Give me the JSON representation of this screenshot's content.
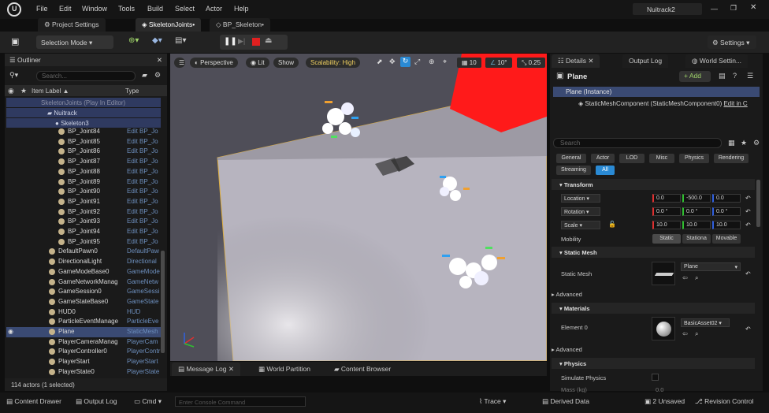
{
  "menubar": {
    "items": [
      "File",
      "Edit",
      "Window",
      "Tools",
      "Build",
      "Select",
      "Actor",
      "Help"
    ],
    "project": "Nuitrack2"
  },
  "tabs": [
    {
      "label": "Project Settings"
    },
    {
      "label": "SkeletonJoints•"
    },
    {
      "label": "BP_Skeleton•"
    }
  ],
  "toolbar": {
    "mode_label": "Selection Mode",
    "settings_label": "Settings"
  },
  "outliner": {
    "title": "Outliner",
    "search_placeholder": "Search...",
    "col_label": "Item Label ▲",
    "col_type": "Type",
    "root": "SkeletonJoints (Play In Editor)",
    "folder": "Nuitrack",
    "skeleton": "Skeleton3",
    "rows": [
      {
        "label": "BP_Joint84",
        "type": "Edit BP_Jo"
      },
      {
        "label": "BP_Joint85",
        "type": "Edit BP_Jo"
      },
      {
        "label": "BP_Joint86",
        "type": "Edit BP_Jo"
      },
      {
        "label": "BP_Joint87",
        "type": "Edit BP_Jo"
      },
      {
        "label": "BP_Joint88",
        "type": "Edit BP_Jo"
      },
      {
        "label": "BP_Joint89",
        "type": "Edit BP_Jo"
      },
      {
        "label": "BP_Joint90",
        "type": "Edit BP_Jo"
      },
      {
        "label": "BP_Joint91",
        "type": "Edit BP_Jo"
      },
      {
        "label": "BP_Joint92",
        "type": "Edit BP_Jo"
      },
      {
        "label": "BP_Joint93",
        "type": "Edit BP_Jo"
      },
      {
        "label": "BP_Joint94",
        "type": "Edit BP_Jo"
      },
      {
        "label": "BP_Joint95",
        "type": "Edit BP_Jo"
      },
      {
        "label": "DefaultPawn0",
        "type": "DefaultPaw"
      },
      {
        "label": "DirectionalLight",
        "type": "Directional"
      },
      {
        "label": "GameModeBase0",
        "type": "GameMode"
      },
      {
        "label": "GameNetworkManag",
        "type": "GameNetw"
      },
      {
        "label": "GameSession0",
        "type": "GameSessi"
      },
      {
        "label": "GameStateBase0",
        "type": "GameState"
      },
      {
        "label": "HUD0",
        "type": "HUD"
      },
      {
        "label": "ParticleEventManage",
        "type": "ParticleEve"
      },
      {
        "label": "Plane",
        "type": "StaticMesh"
      },
      {
        "label": "PlayerCameraManag",
        "type": "PlayerCam"
      },
      {
        "label": "PlayerController0",
        "type": "PlayerContr"
      },
      {
        "label": "PlayerStart",
        "type": "PlayerStart"
      },
      {
        "label": "PlayerState0",
        "type": "PlayerState"
      }
    ],
    "status": "114 actors (1 selected)"
  },
  "viewport": {
    "perspective": "Perspective",
    "lit": "Lit",
    "show": "Show",
    "scalability": "Scalability: High",
    "grid": "10",
    "angle": "10°",
    "scale": "0.25"
  },
  "bottom_tabs": [
    "Message Log",
    "World Partition",
    "Content Browser"
  ],
  "details": {
    "tab_details": "Details",
    "tab_output": "Output Log",
    "tab_world": "World Settin...",
    "object": "Plane",
    "add_label": "+ Add",
    "instance": "Plane (Instance)",
    "component": "StaticMeshComponent (StaticMeshComponent0)",
    "edit_in": "Edit in C",
    "search_placeholder": "Search",
    "filters": [
      "General",
      "Actor",
      "LOD",
      "Misc",
      "Physics",
      "Rendering",
      "Streaming",
      "All"
    ],
    "transform": "Transform",
    "location_label": "Location",
    "rotation_label": "Rotation",
    "scale_label": "Scale",
    "location": [
      "0.0",
      "-500.0",
      "0.0"
    ],
    "rotation": [
      "0.0 °",
      "0.0 °",
      "0.0 °"
    ],
    "scale": [
      "10.0",
      "10.0",
      "10.0"
    ],
    "mobility": "Mobility",
    "mobility_options": [
      "Static",
      "Stationa",
      "Movable"
    ],
    "static_mesh_section": "Static Mesh",
    "static_mesh_label": "Static Mesh",
    "static_mesh_value": "Plane",
    "advanced": "Advanced",
    "materials": "Materials",
    "element0": "Element 0",
    "material_value": "BasicAsset02",
    "physics": "Physics",
    "simulate_physics": "Simulate Physics",
    "mass": "Mass (kg)",
    "mass_value": "0.0"
  },
  "statusbar": {
    "content_drawer": "Content Drawer",
    "output_log": "Output Log",
    "cmd": "Cmd",
    "console_placeholder": "Enter Console Command",
    "trace": "Trace",
    "derived": "Derived Data",
    "unsaved": "2 Unsaved",
    "revision": "Revision Control"
  },
  "colors": {
    "accent": "#2a8ad4",
    "selection": "#3a4a73",
    "play_stop": "#e02020"
  }
}
